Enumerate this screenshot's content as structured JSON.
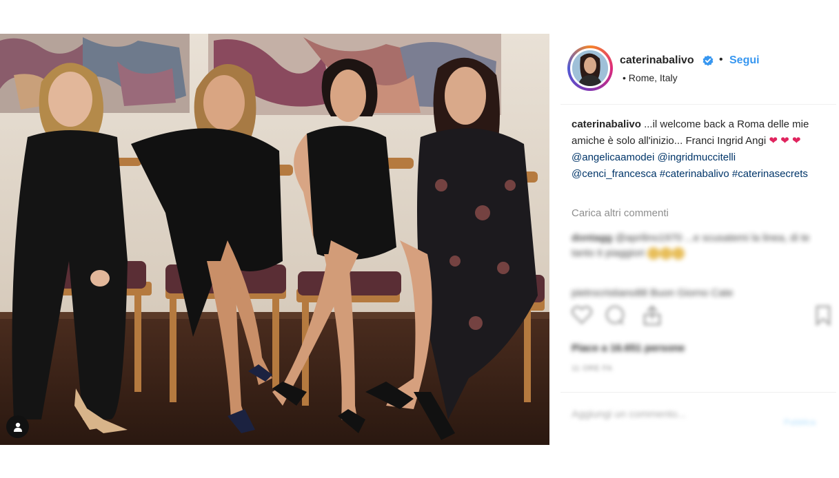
{
  "post": {
    "username": "caterinabalivo",
    "verified": true,
    "follow_label": "Segui",
    "separator": "•",
    "location": "• Rome, Italy",
    "caption_author": "caterinabalivo",
    "caption_text": "...il welcome back a Roma delle mie amiche è solo all'inizio... Franci Ingrid Angi",
    "caption_mentions": [
      "@angelicaamodei",
      "@ingridmuccitelli",
      "@cenci_francesca"
    ],
    "caption_hashtags": [
      "#caterinabalivo",
      "#caterinasecrets"
    ],
    "load_more_comments": "Carica altri commenti",
    "comment1_author": "dontagg",
    "comment1_text": "@aprilino1970 ...e scusatemi la linea, di te tanto ti piaggiori",
    "comment2_text": "pietrocristiano88 Buon Giorno Cate",
    "likes_text": "Piace a 16.651 persone",
    "date_text": "11 ORE FA",
    "comment_placeholder": "Aggiungi un commento...",
    "publish_label": "Pubblica"
  },
  "icons": {
    "verified": "verified-badge-icon",
    "tag": "user-tag-icon",
    "like": "heart-icon",
    "comment": "comment-icon",
    "share": "share-icon",
    "save": "bookmark-icon",
    "more": "more-dots-icon"
  },
  "colors": {
    "link": "#3897f0",
    "mention": "#003569",
    "heart": "#e0245e",
    "muted": "#8e8e8e"
  }
}
